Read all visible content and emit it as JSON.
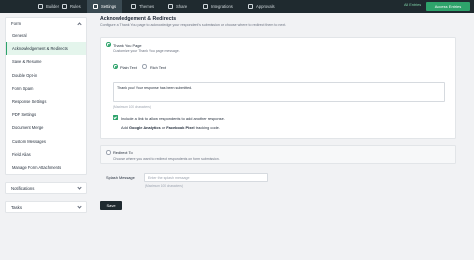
{
  "topnav": {
    "items": [
      {
        "label": "Builder",
        "icon": "builder-icon"
      },
      {
        "label": "Rules",
        "icon": "rules-icon"
      },
      {
        "label": "Settings",
        "icon": "settings-icon"
      },
      {
        "label": "Themes",
        "icon": "themes-icon"
      },
      {
        "label": "Share",
        "icon": "share-icon"
      },
      {
        "label": "Integrations",
        "icon": "integrations-icon"
      },
      {
        "label": "Approvals",
        "icon": "approvals-icon"
      }
    ],
    "all_entries": "All Entries",
    "access_entries": "Access Entries",
    "colors": {
      "bar": "#1f2a2f",
      "accent": "#2ea36b"
    }
  },
  "sidebar": {
    "form_header": "Form",
    "items": [
      "General",
      "Acknowledgement & Redirects",
      "Save & Resume",
      "Double Opt-in",
      "Form Spam",
      "Response Settings",
      "PDF Settings",
      "Document Merge",
      "Custom Messages",
      "Field Alias",
      "Manage Form Attachments"
    ],
    "active_index": 1,
    "notifications": "Notifications",
    "tasks": "Tasks"
  },
  "main": {
    "title": "Acknowledgement & Redirects",
    "description": "Configure a Thank You page to acknowledge your respondent's submission or choose where to redirect them to next.",
    "thank_you": {
      "label": "Thank You Page",
      "description": "Customize your Thank You page message.",
      "plain_text": "Plain Text",
      "rich_text": "Rich Text",
      "message": "Thank you! Your response has been submitted.",
      "max_chars": "(Maximum 100 characters)",
      "checkbox_label": "Include a link to allow respondents to add another response.",
      "tracking_prefix": "Add ",
      "tracking_ga": "Google Analytics",
      "tracking_or": " or ",
      "tracking_fb": "Facebook Pixel",
      "tracking_suffix": " tracking code."
    },
    "redirect": {
      "label": "Redirect To",
      "description": "Choose where you want to redirect respondents on form submission."
    },
    "splash": {
      "label": "Splash Message",
      "placeholder": "Enter the splash message",
      "max_chars": "(Maximum 100 characters)"
    },
    "save_label": "Save"
  }
}
